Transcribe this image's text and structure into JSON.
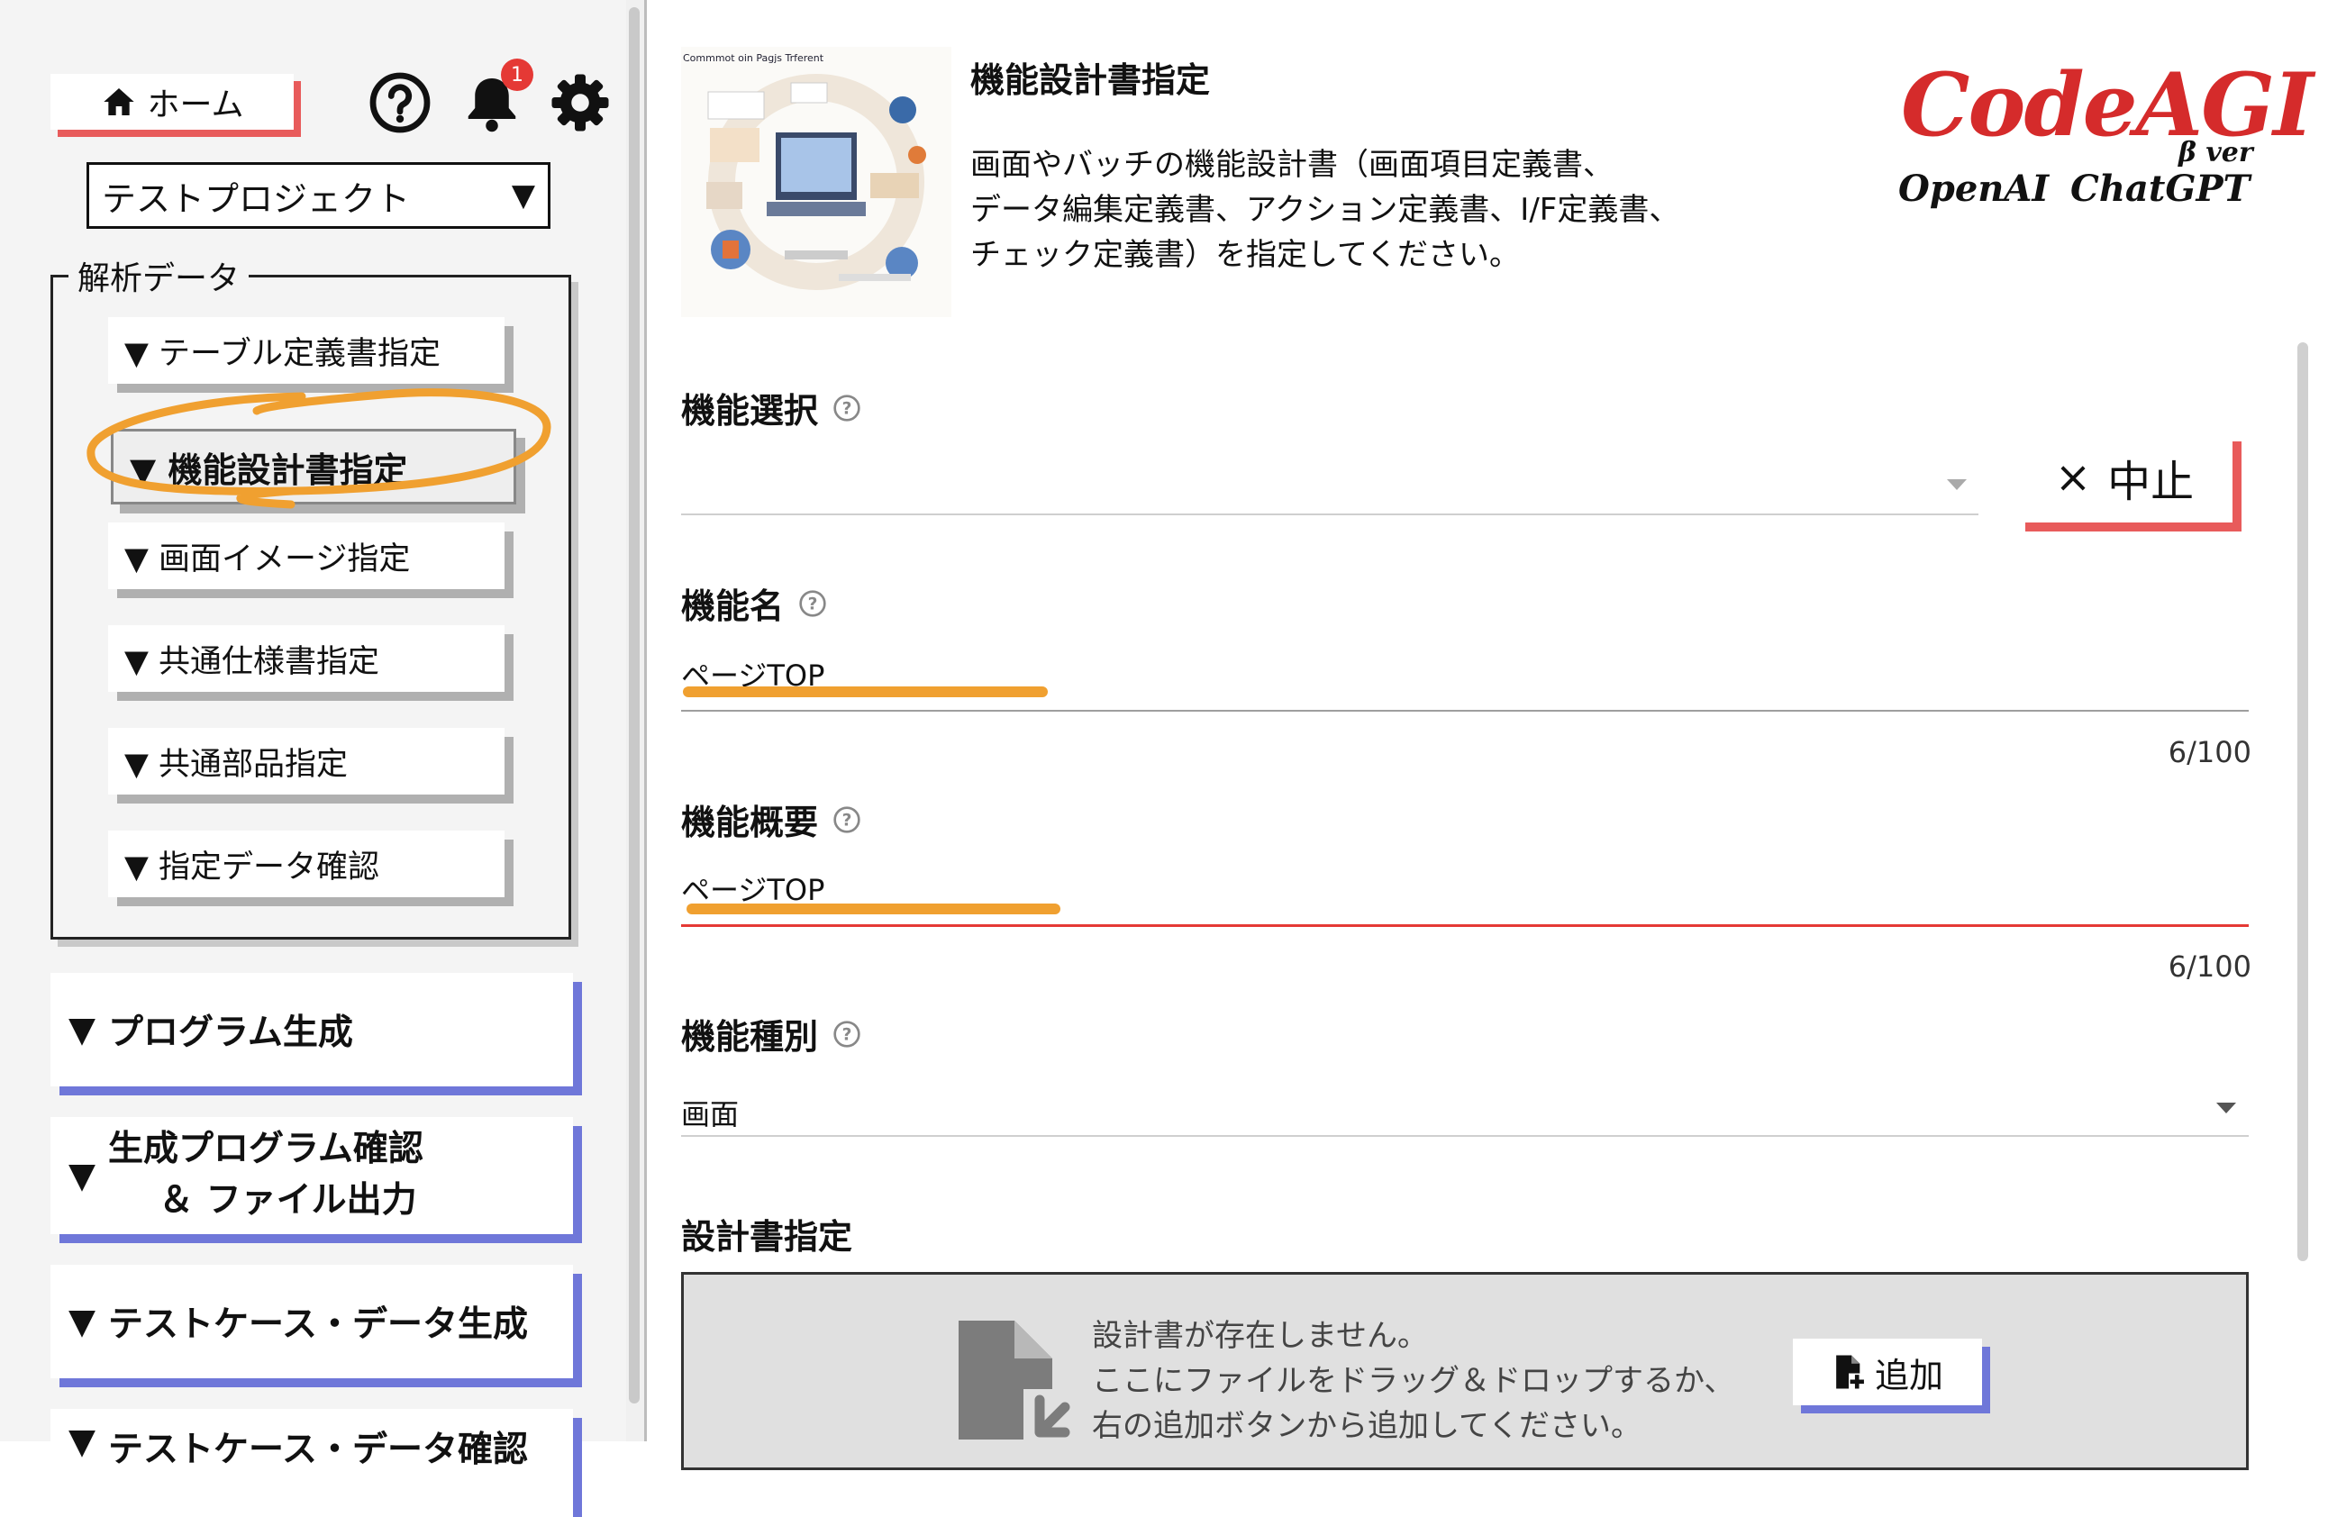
{
  "sidebar": {
    "home_label": "ホーム",
    "notification_count": "1",
    "project_select": {
      "value": "テストプロジェクト",
      "arrow": "▼"
    },
    "analysis_legend": "解析データ",
    "analysis_items": [
      {
        "label": "▼ テーブル定義書指定"
      },
      {
        "label": "▼ 機能設計書指定",
        "active": true
      },
      {
        "label": "▼ 画面イメージ指定"
      },
      {
        "label": "▼ 共通仕様書指定"
      },
      {
        "label": "▼ 共通部品指定"
      },
      {
        "label": "▼ 指定データ確認"
      }
    ],
    "main_items": [
      {
        "tri": "▼",
        "label": "プログラム生成"
      },
      {
        "tri": "▼",
        "line1": "生成プログラム確認",
        "line2": "＆ ファイル出力"
      },
      {
        "tri": "▼",
        "label": "テストケース・データ生成"
      },
      {
        "tri": "▼",
        "label": "テストケース・データ確認"
      }
    ]
  },
  "header": {
    "title": "機能設計書指定",
    "description_lines": [
      "画面やバッチの機能設計書（画面項目定義書、",
      "データ編集定義書、アクション定義書、I/F定義書、",
      "チェック定義書）を指定してください。"
    ],
    "thumbnail_caption": "Commmot oin Pagjs Trferent"
  },
  "logo": {
    "name": "CodeAGI",
    "beta": "β ver",
    "openai": "OpenAI",
    "chatgpt": "ChatGPT"
  },
  "form": {
    "function_select": {
      "label": "機能選択",
      "value": ""
    },
    "cancel_button": {
      "icon": "×",
      "label": "中止"
    },
    "function_name": {
      "label": "機能名",
      "value": "ページTOP",
      "counter": "6/100"
    },
    "function_summary": {
      "label": "機能概要",
      "value": "ページTOP",
      "counter": "6/100"
    },
    "function_type": {
      "label": "機能種別",
      "value": "画面"
    },
    "spec_section": {
      "label": "設計書指定",
      "empty_lines": [
        "設計書が存在しません。",
        "ここにファイルをドラッグ＆ドロップするか、",
        "右の追加ボタンから追加してください。"
      ],
      "add_button": "追加"
    }
  },
  "colors": {
    "accent_red": "#e85b5b",
    "accent_blue": "#6f77d9",
    "logo_red": "#d52b2b",
    "highlight_orange": "#f0a030",
    "badge_red": "#e53935"
  }
}
